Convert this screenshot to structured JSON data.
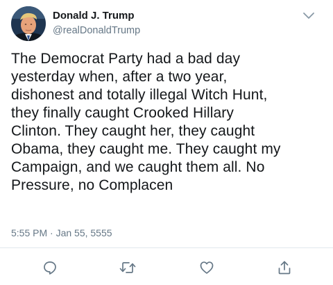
{
  "author": {
    "name": "Donald J. Trump",
    "handle": "@realDonaldTrump"
  },
  "tweet": {
    "lines": [
      "The Democrat Party had a bad day",
      "yesterday when, after a two year,",
      "dishonest and totally illegal Witch Hunt,",
      "they finally caught Crooked Hillary",
      "Clinton. They caught her, they caught",
      "Obama, they caught me. They caught my",
      "Campaign, and we caught them all. No",
      "Pressure, no Complacen"
    ],
    "timestamp": "5:55 PM · Jan 55, 5555"
  },
  "icons": {
    "menu": "chevron-down-icon",
    "reply": "reply-icon",
    "retweet": "retweet-icon",
    "like": "heart-icon",
    "share": "share-icon"
  },
  "colors": {
    "text": "#14171a",
    "secondary": "#657786",
    "icon": "#657786",
    "divider": "#e1e8ed"
  }
}
